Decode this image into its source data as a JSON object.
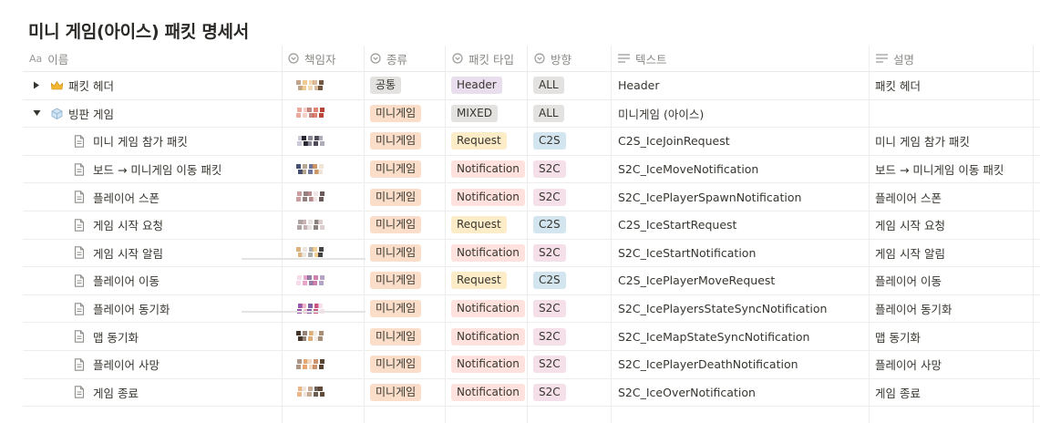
{
  "page": {
    "title": "미니 게임(아이스) 패킷 명세서"
  },
  "columns": {
    "name": "이름",
    "owner": "책임자",
    "kind": "종류",
    "packet_type": "패킷 타입",
    "direction": "방향",
    "text": "텍스트",
    "desc": "설명"
  },
  "icons": {
    "name": "aa-text-icon",
    "owner": "circle-select-icon",
    "kind": "circle-select-icon",
    "packet_type": "circle-select-icon",
    "direction": "circle-select-icon",
    "text": "lines-text-icon",
    "desc": "lines-text-icon"
  },
  "colors": {
    "tag_gray": "#e3e2e0",
    "tag_orange": "#fadec9",
    "tag_purple": "#e8deee",
    "tag_yellow": "#fdecc8",
    "tag_red": "#ffe2dd",
    "tag_blue": "#d3e5ef",
    "tag_pink": "#f5e0e9"
  },
  "rows": [
    {
      "name": "패킷 헤더",
      "kind": "공통",
      "packet_type": "Header",
      "direction": "ALL",
      "text": "Header",
      "desc": "패킷 헤더"
    },
    {
      "name": "빙판 게임",
      "kind": "미니게임",
      "packet_type": "MIXED",
      "direction": "ALL",
      "text": "미니게임 (아이스)",
      "desc": ""
    },
    {
      "name": "미니 게임 참가 패킷",
      "kind": "미니게임",
      "packet_type": "Request",
      "direction": "C2S",
      "text": "C2S_IceJoinRequest",
      "desc": "미니 게임 참가 패킷"
    },
    {
      "name": "보드 → 미니게임 이동 패킷",
      "kind": "미니게임",
      "packet_type": "Notification",
      "direction": "S2C",
      "text": "S2C_IceMoveNotification",
      "desc": "보드 → 미니게임 이동 패킷"
    },
    {
      "name": "플레이어 스폰",
      "kind": "미니게임",
      "packet_type": "Notification",
      "direction": "S2C",
      "text": "S2C_IcePlayerSpawnNotification",
      "desc": "플레이어 스폰"
    },
    {
      "name": "게임 시작 요청",
      "kind": "미니게임",
      "packet_type": "Request",
      "direction": "C2S",
      "text": "C2S_IceStartRequest",
      "desc": "게임 시작 요청"
    },
    {
      "name": "게임 시작 알림",
      "kind": "미니게임",
      "packet_type": "Notification",
      "direction": "S2C",
      "text": "S2C_IceStartNotification",
      "desc": "게임 시작 알림"
    },
    {
      "name": "플레이어 이동",
      "kind": "미니게임",
      "packet_type": "Request",
      "direction": "C2S",
      "text": "C2S_IcePlayerMoveRequest",
      "desc": "플레이어 이동"
    },
    {
      "name": "플레이어 동기화",
      "kind": "미니게임",
      "packet_type": "Notification",
      "direction": "S2C",
      "text": "S2C_IcePlayersStateSyncNotification",
      "desc": "플레이어 동기화"
    },
    {
      "name": "맵 동기화",
      "kind": "미니게임",
      "packet_type": "Notification",
      "direction": "S2C",
      "text": "S2C_IceMapStateSyncNotification",
      "desc": "맵 동기화"
    },
    {
      "name": "플레이어 사망",
      "kind": "미니게임",
      "packet_type": "Notification",
      "direction": "S2C",
      "text": "S2C_IcePlayerDeathNotification",
      "desc": "플레이어 사망"
    },
    {
      "name": "게임 종료",
      "kind": "미니게임",
      "packet_type": "Notification",
      "direction": "S2C",
      "text": "S2C_IceOverNotification",
      "desc": "게임 종료"
    }
  ]
}
